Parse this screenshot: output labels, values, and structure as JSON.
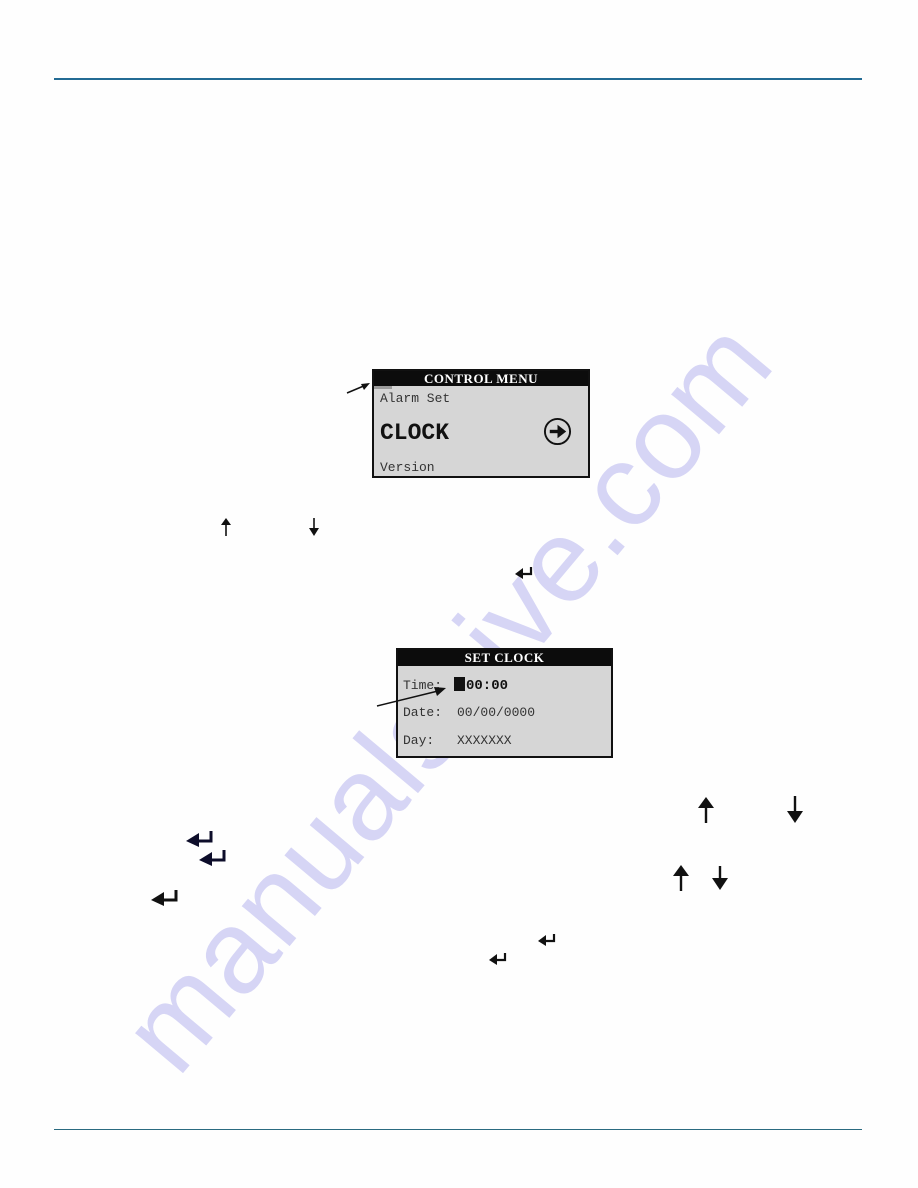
{
  "page": {
    "watermark": "manualshive.com",
    "rule_color": "#236b94"
  },
  "control_menu": {
    "title": "CONTROL MENU",
    "items": [
      "Alarm Set",
      "CLOCK",
      "Version"
    ],
    "selected": "CLOCK",
    "enter_icon": "circled-right-arrow"
  },
  "set_clock": {
    "title": "SET CLOCK",
    "fields": [
      {
        "label": "Time:",
        "value": "00:00"
      },
      {
        "label": "Date:",
        "value": "00/00/0000"
      },
      {
        "label": "Day:",
        "value": "XXXXXXX"
      }
    ]
  },
  "inline_icons": [
    "up-arrow",
    "down-arrow",
    "enter-arrow",
    "up-arrow",
    "down-arrow",
    "enter-arrow",
    "enter-arrow",
    "up-arrow",
    "down-arrow",
    "enter-arrow",
    "enter-arrow",
    "enter-arrow"
  ]
}
